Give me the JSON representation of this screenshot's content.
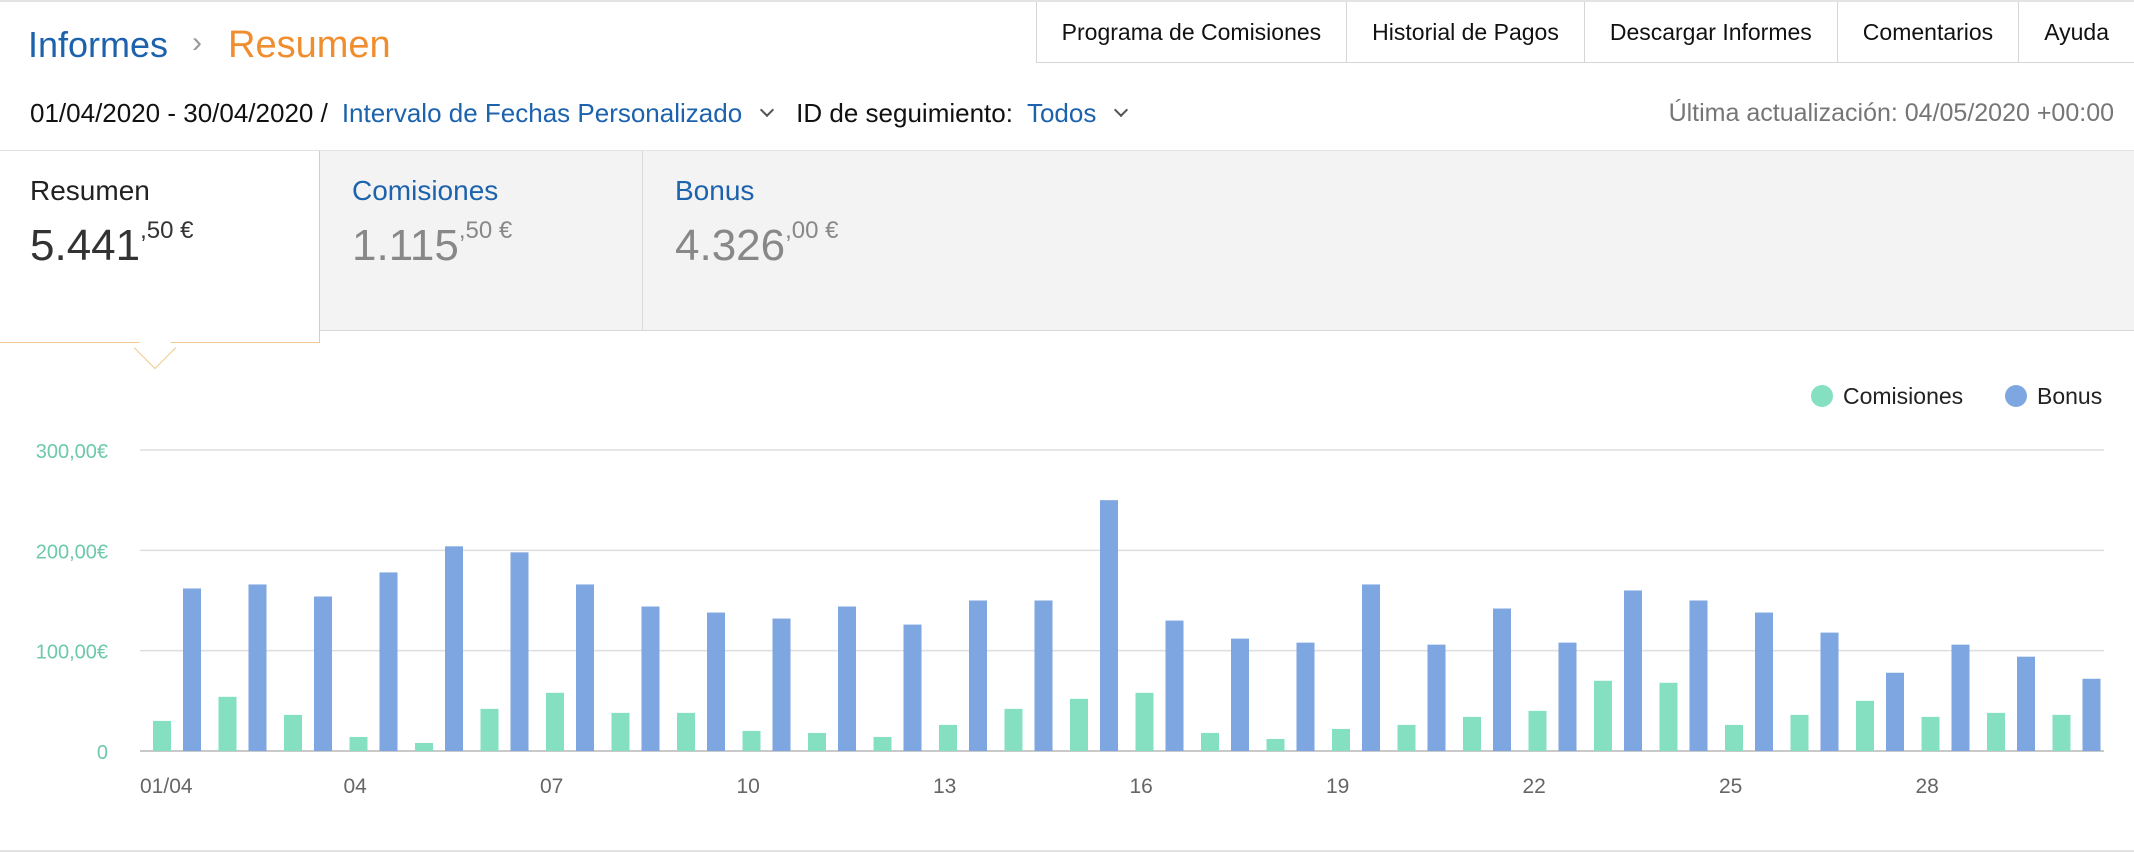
{
  "breadcrumb": {
    "parent": "Informes",
    "separator": "›",
    "current": "Resumen"
  },
  "topnav": [
    {
      "label": "Programa de Comisiones",
      "name": "topnav-programa-de-comisiones"
    },
    {
      "label": "Historial de Pagos",
      "name": "topnav-historial-de-pagos"
    },
    {
      "label": "Descargar Informes",
      "name": "topnav-descargar-informes"
    },
    {
      "label": "Comentarios",
      "name": "topnav-comentarios"
    },
    {
      "label": "Ayuda",
      "name": "topnav-ayuda"
    }
  ],
  "filters": {
    "date_range": "01/04/2020 - 30/04/2020 /",
    "interval_label": "Intervalo de Fechas Personalizado",
    "tracking_label": "ID de seguimiento:",
    "tracking_value": "Todos"
  },
  "updated": "Última actualización: 04/05/2020 +00:00",
  "summary_tabs": [
    {
      "title": "Resumen",
      "amount_int": "5.441",
      "amount_dec": ",50 €",
      "active": true
    },
    {
      "title": "Comisiones",
      "amount_int": "1.115",
      "amount_dec": ",50 €",
      "active": false
    },
    {
      "title": "Bonus",
      "amount_int": "4.326",
      "amount_dec": ",00 €",
      "active": false
    }
  ],
  "colors": {
    "comisiones": "#84e0c1",
    "bonus": "#7ea6e0",
    "axis_label": "#6cc9a9",
    "link": "#1c62ad",
    "accent": "#f08d2e"
  },
  "chart_data": {
    "type": "bar",
    "legend_position": "top-right",
    "grid": true,
    "ylim": [
      0,
      300
    ],
    "y_ticks": [
      {
        "value": 0,
        "label": "0"
      },
      {
        "value": 100,
        "label": "100,00€"
      },
      {
        "value": 200,
        "label": "200,00€"
      },
      {
        "value": 300,
        "label": "300,00€"
      }
    ],
    "x_tick_labels": [
      {
        "day": 1,
        "label": "01/04"
      },
      {
        "day": 4,
        "label": "04"
      },
      {
        "day": 7,
        "label": "07"
      },
      {
        "day": 10,
        "label": "10"
      },
      {
        "day": 13,
        "label": "13"
      },
      {
        "day": 16,
        "label": "16"
      },
      {
        "day": 19,
        "label": "19"
      },
      {
        "day": 22,
        "label": "22"
      },
      {
        "day": 25,
        "label": "25"
      },
      {
        "day": 28,
        "label": "28"
      }
    ],
    "categories": [
      1,
      2,
      3,
      4,
      5,
      6,
      7,
      8,
      9,
      10,
      11,
      12,
      13,
      14,
      15,
      16,
      17,
      18,
      19,
      20,
      21,
      22,
      23,
      24,
      25,
      26,
      27,
      28,
      29,
      30
    ],
    "series": [
      {
        "name": "Comisiones",
        "values": [
          30,
          54,
          36,
          14,
          8,
          42,
          58,
          38,
          38,
          20,
          18,
          14,
          26,
          42,
          52,
          58,
          18,
          12,
          22,
          26,
          34,
          40,
          70,
          68,
          26,
          36,
          50,
          34,
          38,
          36
        ]
      },
      {
        "name": "Bonus",
        "values": [
          162,
          166,
          154,
          178,
          204,
          198,
          166,
          144,
          138,
          132,
          144,
          126,
          150,
          150,
          250,
          130,
          112,
          108,
          166,
          106,
          142,
          108,
          160,
          150,
          138,
          118,
          78,
          106,
          94,
          72
        ]
      }
    ]
  }
}
